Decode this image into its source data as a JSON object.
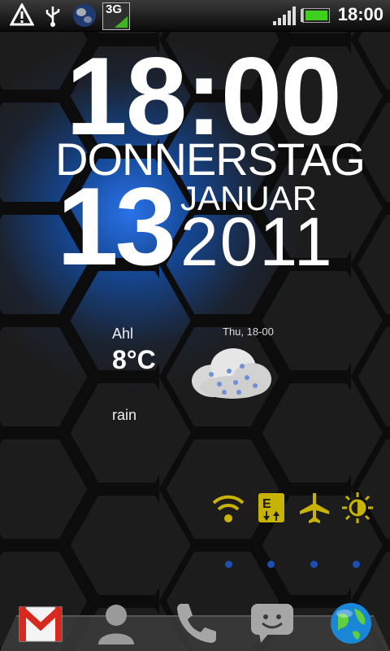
{
  "status_bar": {
    "time": "18:00",
    "network_type": "3G",
    "icons": [
      "warning-icon",
      "usb-icon",
      "globe-icon",
      "3g-icon",
      "signal-icon",
      "battery-icon"
    ]
  },
  "clock_widget": {
    "time": "18:00",
    "weekday": "DONNERSTAG",
    "day": "13",
    "month": "JANUAR",
    "year": "2011"
  },
  "weather_widget": {
    "city": "Ahl",
    "temperature": "8°C",
    "condition": "rain",
    "forecast_time": "Thu, 18-00",
    "icon": "rain-cloud-icon"
  },
  "quick_toggles": [
    {
      "name": "wifi-toggle",
      "icon": "wifi-icon"
    },
    {
      "name": "data-toggle",
      "icon": "edge-data-icon"
    },
    {
      "name": "airplane-toggle",
      "icon": "airplane-icon"
    },
    {
      "name": "brightness-toggle",
      "icon": "brightness-icon"
    }
  ],
  "page_indicator": {
    "count": 4
  },
  "dock": [
    {
      "name": "gmail",
      "icon": "gmail-icon"
    },
    {
      "name": "contacts",
      "icon": "person-icon"
    },
    {
      "name": "phone",
      "icon": "phone-icon"
    },
    {
      "name": "messages",
      "icon": "message-icon"
    },
    {
      "name": "browser",
      "icon": "globe-icon"
    }
  ],
  "colors": {
    "accent_blue": "#1c6bff",
    "toggle_yellow": "#c8b300"
  }
}
